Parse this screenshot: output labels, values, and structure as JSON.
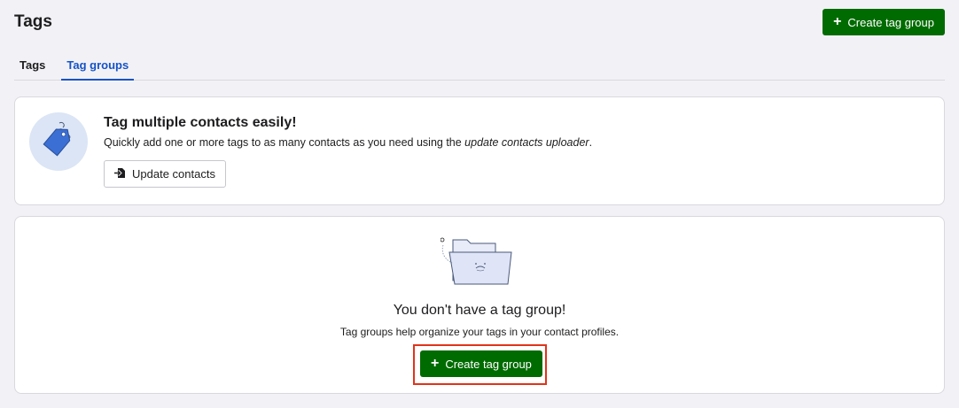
{
  "header": {
    "title": "Tags",
    "create_button_label": "Create tag group"
  },
  "tabs": [
    {
      "label": "Tags",
      "active": false
    },
    {
      "label": "Tag groups",
      "active": true
    }
  ],
  "info_card": {
    "title": "Tag multiple contacts easily!",
    "description_prefix": "Quickly add one or more tags to as many contacts as you need using the ",
    "description_link": "update contacts uploader",
    "description_suffix": ".",
    "button_label": "Update contacts",
    "icon": "tag-icon"
  },
  "empty_state": {
    "title": "You don't have a tag group!",
    "description": "Tag groups help organize your tags in your contact profiles.",
    "button_label": "Create tag group",
    "icon": "empty-folder-icon"
  },
  "colors": {
    "primary": "#006b00",
    "tab_active": "#1553c7",
    "highlight": "#e0341a",
    "background": "#f2f2f6"
  }
}
